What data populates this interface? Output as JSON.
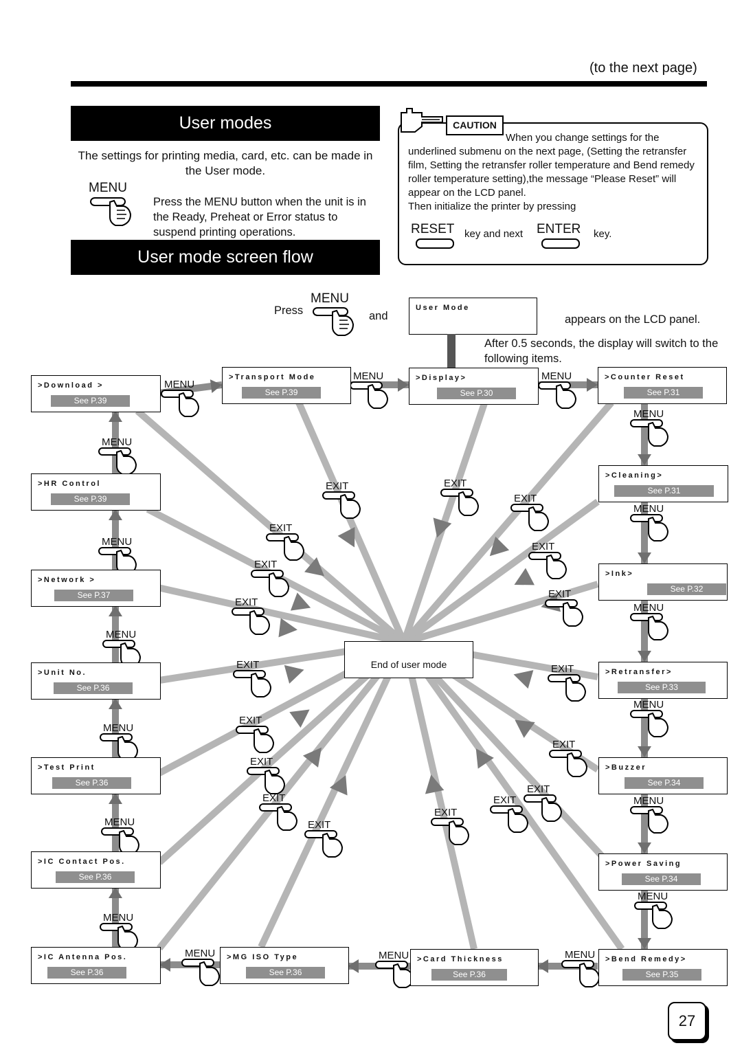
{
  "header": {
    "next_page": "(to the next page)"
  },
  "user_modes": {
    "title": "User modes",
    "intro": "The settings for printing media, card, etc. can be made in the User mode.",
    "menu_key": "MENU",
    "instruction": "Press the MENU button when the unit is in the Ready, Preheat or Error status to suspend printing operations."
  },
  "caution": {
    "badge": "CAUTION",
    "line1": "When you change settings for the",
    "body": "underlined submenu on the next page, (Setting the retransfer film, Setting the retransfer roller temperature and Bend remedy roller temperature setting),the message “Please Reset” will appear on the LCD panel.",
    "line_last": "Then initialize the printer by pressing",
    "reset_key": "RESET",
    "middle": "key and next",
    "enter_key": "ENTER",
    "end": "key."
  },
  "flow": {
    "title": "User mode screen flow",
    "press": "Press",
    "menu_key": "MENU",
    "and": "and",
    "lcd_title": "User Mode",
    "appears": "appears on the LCD panel.",
    "after": "After 0.5 seconds, the display will switch to the following items.",
    "end_label": "End of user mode",
    "menu_label": "MENU",
    "exit_label": "EXIT",
    "screens": [
      {
        "id": "download",
        "title": ">Download >",
        "ref": "See P.39"
      },
      {
        "id": "transport-mode",
        "title": ">Transport Mode",
        "ref": "See P.39"
      },
      {
        "id": "display",
        "title": ">Display>",
        "ref": "See P.30"
      },
      {
        "id": "counter-reset",
        "title": ">Counter Reset",
        "ref": "See P.31"
      },
      {
        "id": "hr-control",
        "title": ">HR Control",
        "ref": "See P.39"
      },
      {
        "id": "cleaning",
        "title": ">Cleaning>",
        "ref": "See P.31"
      },
      {
        "id": "network",
        "title": ">Network >",
        "ref": "See P.37"
      },
      {
        "id": "ink",
        "title": ">Ink>",
        "ref": "See P.32"
      },
      {
        "id": "unit-no",
        "title": ">Unit No.",
        "ref": "See P.36"
      },
      {
        "id": "retransfer",
        "title": ">Retransfer>",
        "ref": "See P.33"
      },
      {
        "id": "test-print",
        "title": ">Test Print",
        "ref": "See P.36"
      },
      {
        "id": "buzzer",
        "title": ">Buzzer",
        "ref": "See P.34"
      },
      {
        "id": "ic-contact-pos",
        "title": ">IC Contact Pos.",
        "ref": "See P.36"
      },
      {
        "id": "power-saving",
        "title": ">Power Saving",
        "ref": "See P.34"
      },
      {
        "id": "ic-antenna-pos",
        "title": ">IC Antenna Pos.",
        "ref": "See P.36"
      },
      {
        "id": "mg-iso-type",
        "title": ">MG ISO Type",
        "ref": "See P.36"
      },
      {
        "id": "card-thickness",
        "title": ">Card Thickness",
        "ref": "See P.36"
      },
      {
        "id": "bend-remedy",
        "title": ">Bend Remedy>",
        "ref": "See P.35"
      }
    ]
  },
  "page_number": "27"
}
